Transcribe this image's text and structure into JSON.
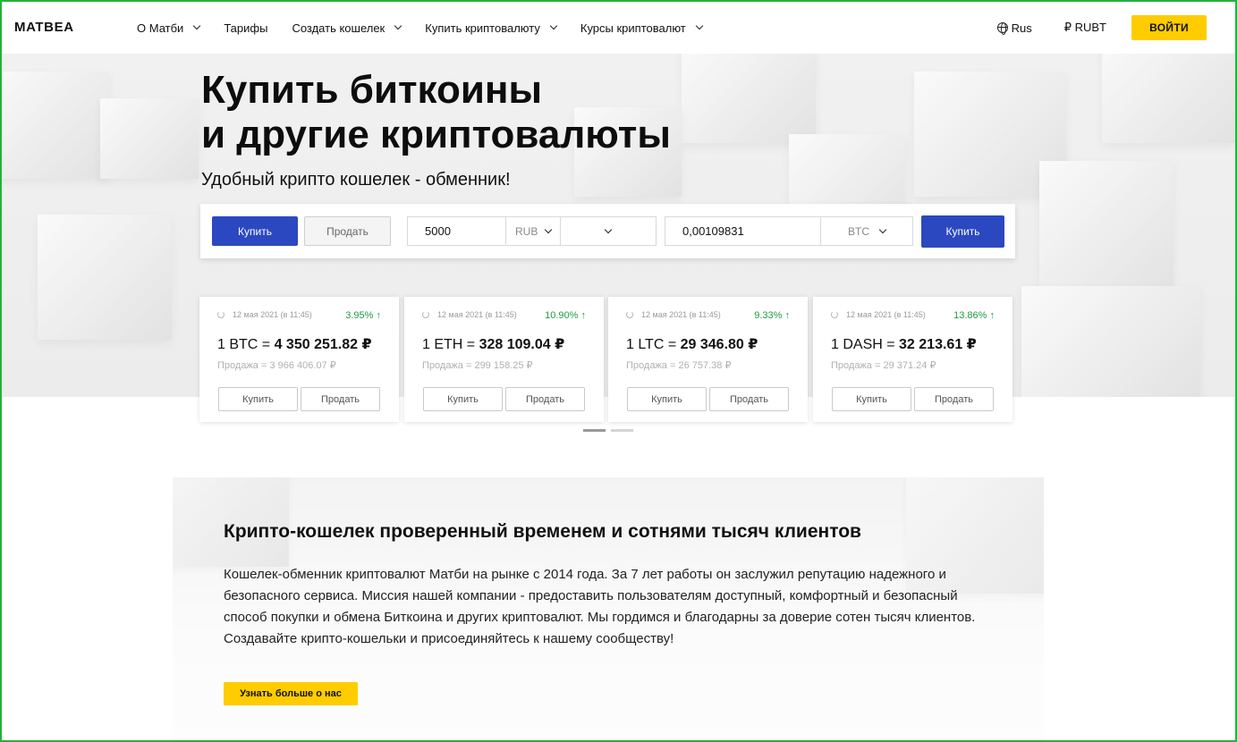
{
  "header": {
    "logo": "MATBEA",
    "nav": [
      {
        "label": "О Матби",
        "has_dropdown": true
      },
      {
        "label": "Тарифы",
        "has_dropdown": false
      },
      {
        "label": "Создать кошелек",
        "has_dropdown": true
      },
      {
        "label": "Купить криптовалюту",
        "has_dropdown": true
      },
      {
        "label": "Курсы криптовалют",
        "has_dropdown": true
      }
    ],
    "language": "Rus",
    "currency": "₽ RUBT",
    "login_label": "ВОЙТИ"
  },
  "hero": {
    "title_line1": "Купить биткоины",
    "title_line2": "и другие криптовалюты",
    "subtitle": "Удобный крипто кошелек - обменник!"
  },
  "exchange": {
    "buy_tab": "Купить",
    "sell_tab": "Продать",
    "give_amount": "5000",
    "give_currency": "RUB",
    "payment_method": "",
    "get_amount": "0,00109831",
    "get_currency": "BTC",
    "submit_label": "Купить"
  },
  "rates": {
    "cards": [
      {
        "date": "12 мая 2021 (в 11:45)",
        "change": "3.95% ↑",
        "prefix": "1 BTC = ",
        "price": "4 350 251.82 ₽",
        "sell": "Продажа = 3 966 406.07 ₽",
        "buy_label": "Купить",
        "sell_label": "Продать"
      },
      {
        "date": "12 мая 2021 (в 11:45)",
        "change": "10.90% ↑",
        "prefix": "1 ETH = ",
        "price": "328 109.04 ₽",
        "sell": "Продажа = 299 158.25 ₽",
        "buy_label": "Купить",
        "sell_label": "Продать"
      },
      {
        "date": "12 мая 2021 (в 11:45)",
        "change": "9.33% ↑",
        "prefix": "1 LTC = ",
        "price": "29 346.80 ₽",
        "sell": "Продажа = 26 757.38 ₽",
        "buy_label": "Купить",
        "sell_label": "Продать"
      },
      {
        "date": "12 мая 2021 (в 11:45)",
        "change": "13.86% ↑",
        "prefix": "1 DASH = ",
        "price": "32 213.61 ₽",
        "sell": "Продажа = 29 371.24 ₽",
        "buy_label": "Купить",
        "sell_label": "Продать"
      }
    ],
    "active_page": 1,
    "page_count": 2
  },
  "about": {
    "title": "Крипто-кошелек проверенный временем и сотнями тысяч клиентов",
    "text_line1": "Кошелек-обменник криптовалют Матби на рынке с 2014 года. За 7 лет работы он заслужил репутацию надежного и",
    "text_line2": "безопасного сервиса. Миссия нашей компании - предоставить пользователям доступный, комфортный и безопасный",
    "text_line3": "способ покупки и обмена Биткоина и других криптовалют. Мы гордимся и благодарны за доверие сотен тысяч клиентов.",
    "text_line4": "Создавайте крипто-кошельки и присоединяйтесь к нашему сообществу!",
    "button_label": "Узнать больше о нас"
  },
  "colors": {
    "accent_blue": "#2b48c1",
    "accent_yellow": "#ffcc00",
    "positive_green": "#1e9b46",
    "frame_green": "#22b33a"
  }
}
